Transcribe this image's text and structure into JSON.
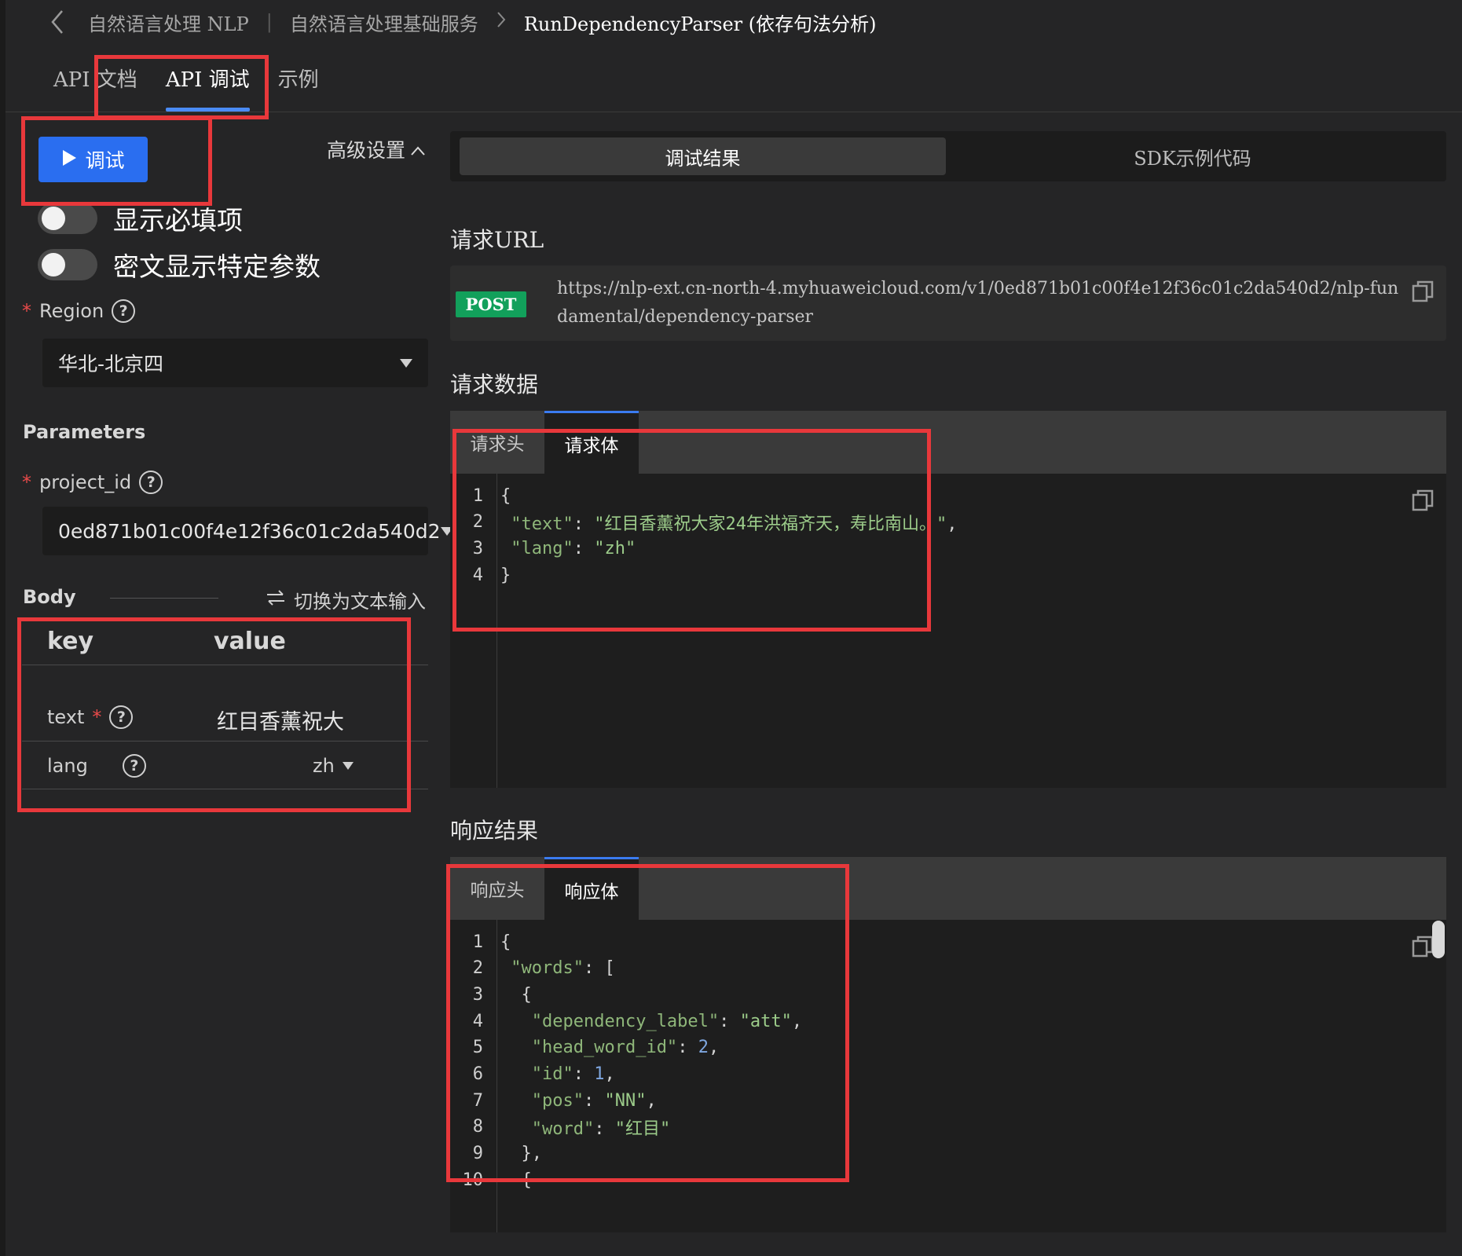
{
  "breadcrumb": {
    "items": [
      "自然语言处理 NLP",
      "自然语言处理基础服务"
    ],
    "current": "RunDependencyParser (依存句法分析)"
  },
  "tabs": [
    "API 文档",
    "API 调试",
    "示例"
  ],
  "left": {
    "run_label": "调试",
    "advanced_label": "高级设置",
    "toggle_required": "显示必填项",
    "toggle_secret": "密文显示特定参数",
    "region_label": "Region",
    "region_value": "华北-北京四",
    "parameters_title": "Parameters",
    "project_id_label": "project_id",
    "project_id_value": "0ed871b01c00f4e12f36c01c2da540d2",
    "body_title": "Body",
    "switch_text_input": "切换为文本输入",
    "kv_header": {
      "key": "key",
      "value": "value"
    },
    "rows": [
      {
        "key": "text",
        "value": "红目香薰祝大"
      },
      {
        "key": "lang",
        "value": "zh"
      }
    ]
  },
  "right": {
    "tab_result": "调试结果",
    "tab_sdk": "SDK示例代码",
    "request_url_title": "请求URL",
    "method": "POST",
    "url": "https://nlp-ext.cn-north-4.myhuaweicloud.com/v1/0ed871b01c00f4e12f36c01c2da540d2/nlp-fundamental/dependency-parser",
    "request_data_title": "请求数据",
    "req_tab_header": "请求头",
    "req_tab_body": "请求体",
    "request_lines": [
      "{",
      " \"text\": \"红目香薰祝大家24年洪福齐天，寿比南山。\",",
      " \"lang\": \"zh\"",
      "}"
    ],
    "response_title": "响应结果",
    "resp_tab_header": "响应头",
    "resp_tab_body": "响应体",
    "response_lines": [
      "{",
      " \"words\": [",
      "  {",
      "   \"dependency_label\": \"att\",",
      "   \"head_word_id\": 2,",
      "   \"id\": 1,",
      "   \"pos\": \"NN\",",
      "   \"word\": \"红目\"",
      "  },",
      "  {"
    ]
  },
  "colors": {
    "accent_blue": "#2a6ef0",
    "post_green": "#12a05b",
    "annotation_red": "#e8383b",
    "required_star": "#e84a4a"
  }
}
